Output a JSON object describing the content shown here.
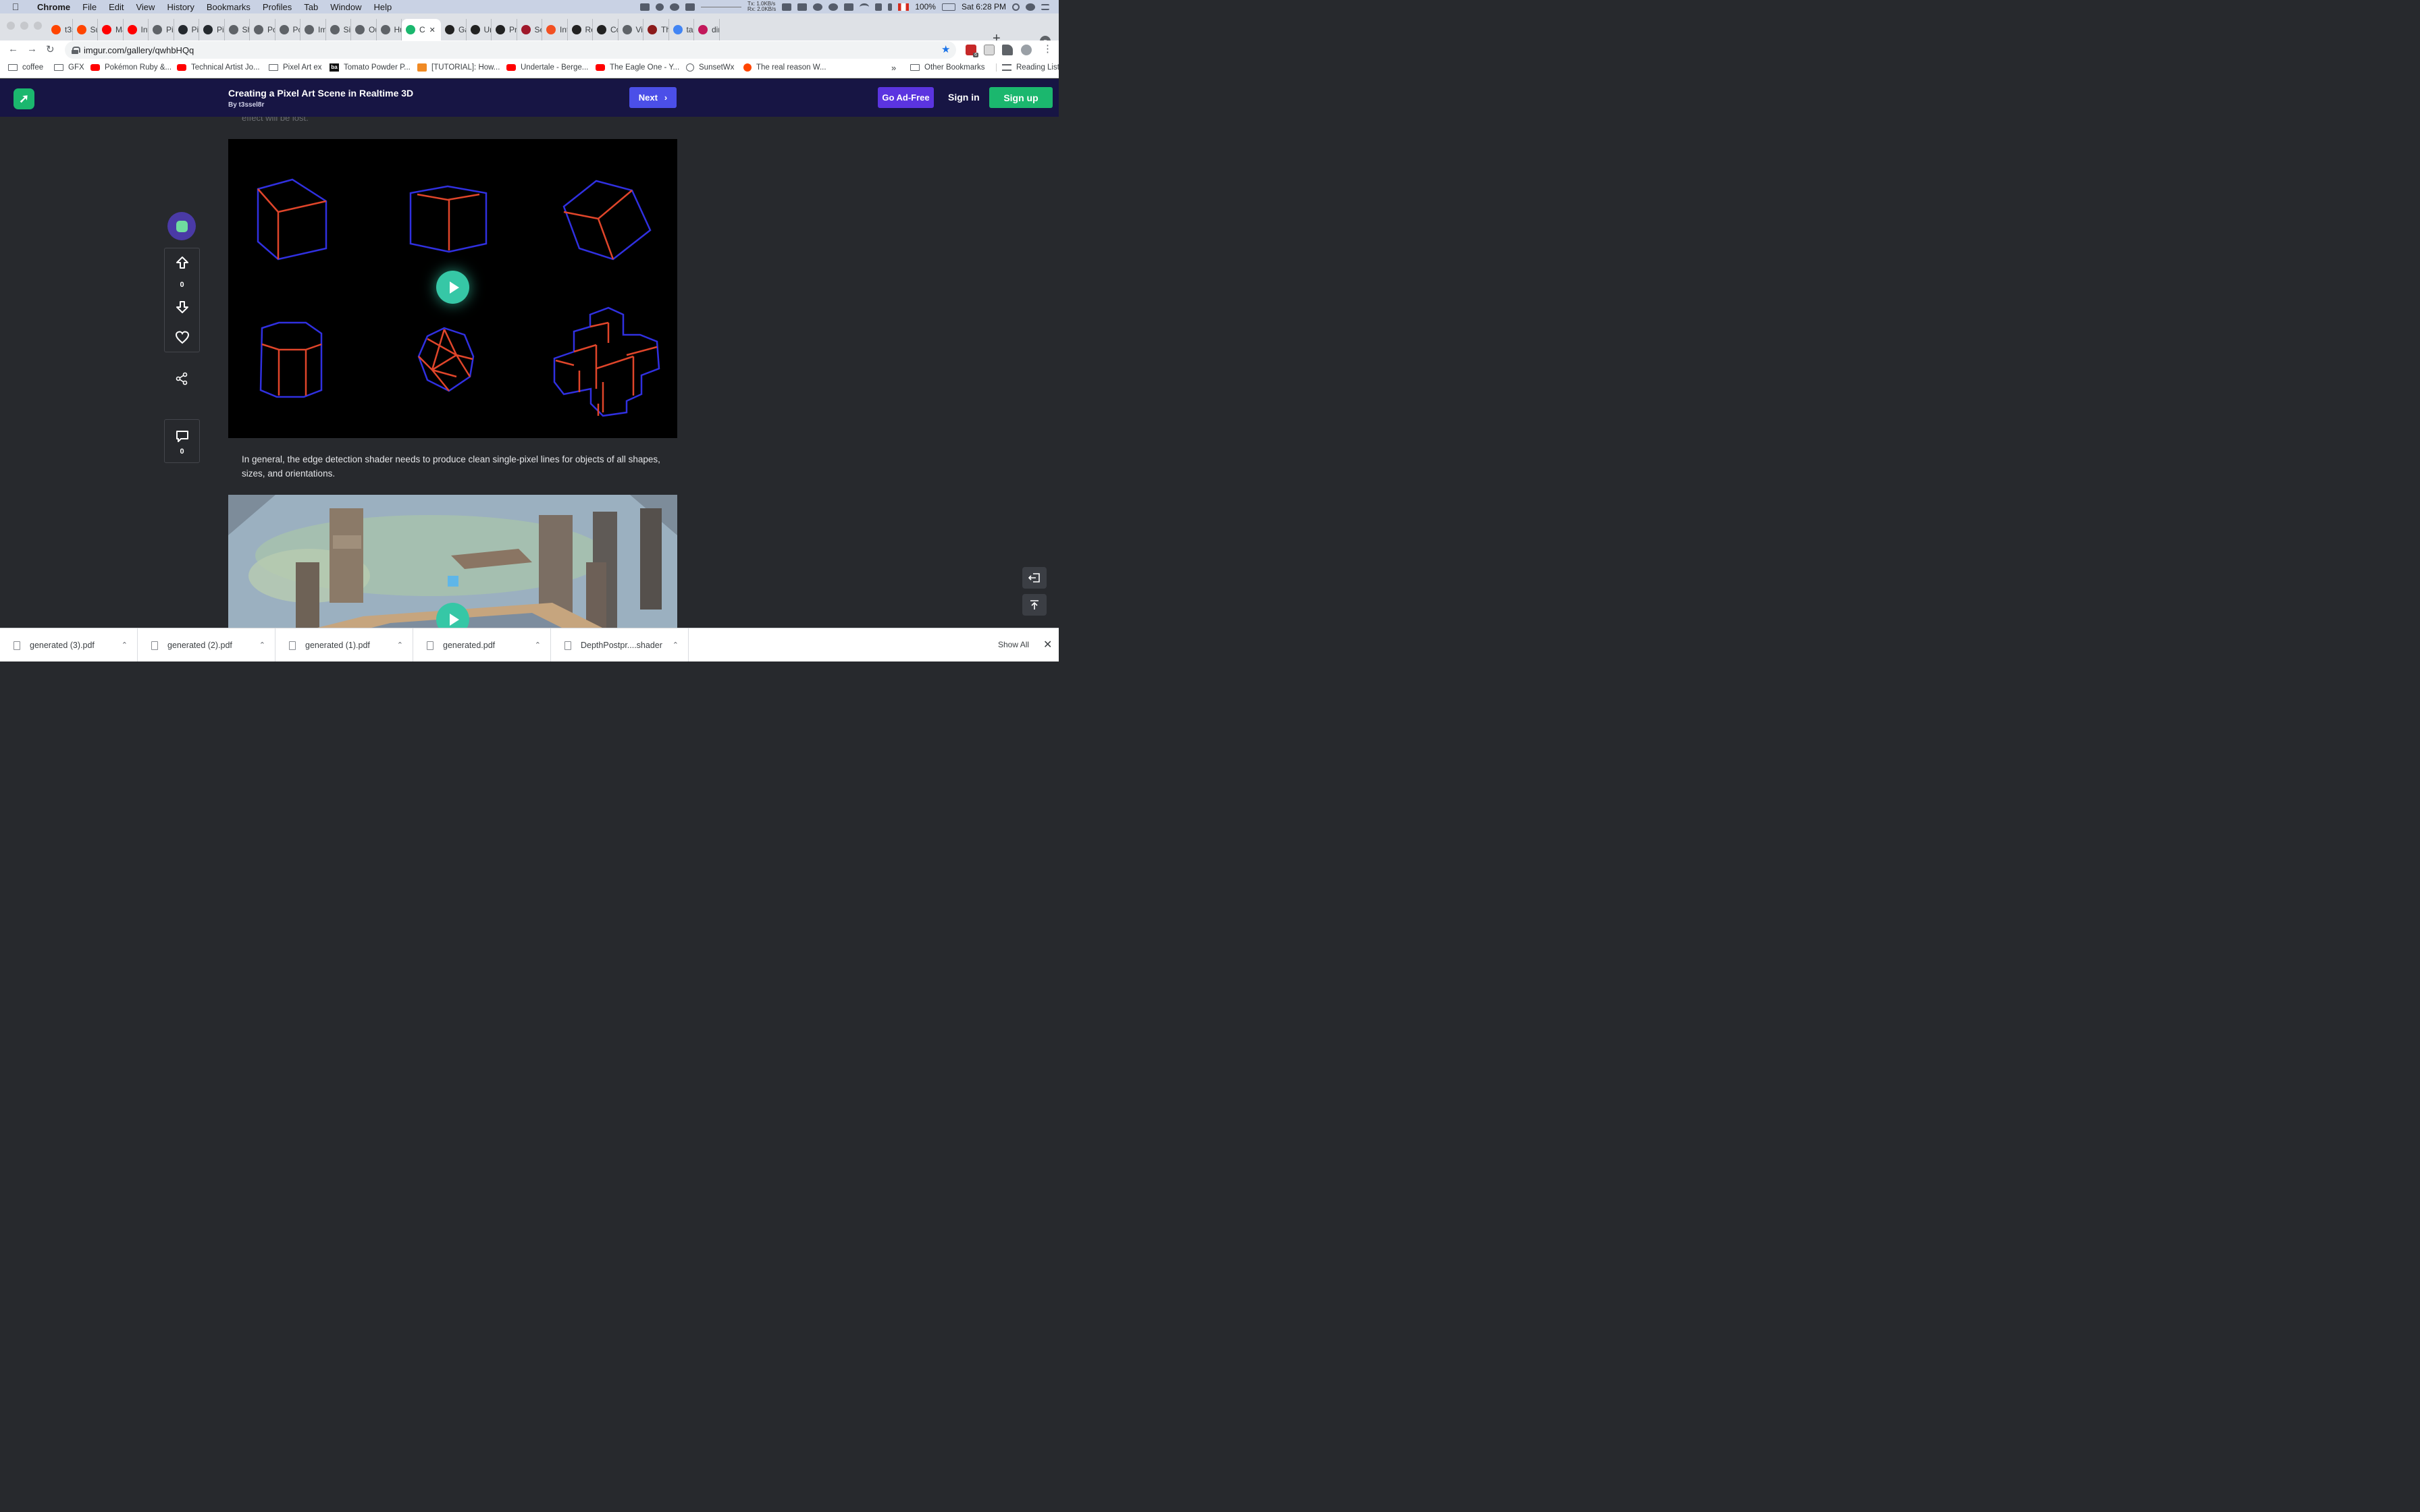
{
  "menubar": {
    "app": "Chrome",
    "items": [
      "File",
      "Edit",
      "View",
      "History",
      "Bookmarks",
      "Profiles",
      "Tab",
      "Window",
      "Help"
    ],
    "net_tx": "Tx: 1.0KB/s",
    "net_rx": "Rx: 2.0KB/s",
    "battery": "100%",
    "clock": "Sat 6:28 PM"
  },
  "tabs": [
    {
      "label": "t3s",
      "icon": "reddit-icon",
      "color": "#ff4500"
    },
    {
      "label": "Sun",
      "icon": "reddit-icon",
      "color": "#ff4500"
    },
    {
      "label": "Mak",
      "icon": "youtube-icon",
      "color": "#ff0000"
    },
    {
      "label": "Intr",
      "icon": "youtube-icon",
      "color": "#ff0000"
    },
    {
      "label": "Pixe",
      "icon": "globe-icon",
      "color": "#5f6368"
    },
    {
      "label": "Pixe",
      "icon": "github-icon",
      "color": "#24292e"
    },
    {
      "label": "Pixe",
      "icon": "github-icon",
      "color": "#24292e"
    },
    {
      "label": "Sha",
      "icon": "globe-icon",
      "color": "#5f6368"
    },
    {
      "label": "Pos",
      "icon": "globe-icon",
      "color": "#5f6368"
    },
    {
      "label": "Pos",
      "icon": "globe-icon",
      "color": "#5f6368"
    },
    {
      "label": "Imp",
      "icon": "globe-icon",
      "color": "#5f6368"
    },
    {
      "label": "Sin",
      "icon": "globe-icon",
      "color": "#5f6368"
    },
    {
      "label": "Out",
      "icon": "globe-icon",
      "color": "#5f6368"
    },
    {
      "label": "Hul",
      "icon": "globe-icon",
      "color": "#5f6368"
    },
    {
      "label": "C",
      "icon": "imgur-icon",
      "color": "#1bb76e",
      "active": true
    },
    {
      "label": "Gan",
      "icon": "paw-icon",
      "color": "#222222"
    },
    {
      "label": "Unit",
      "icon": "paw-icon",
      "color": "#222222"
    },
    {
      "label": "Pro",
      "icon": "paw-icon",
      "color": "#222222"
    },
    {
      "label": "Sec",
      "icon": "star-icon",
      "color": "#a0182b"
    },
    {
      "label": "Intr",
      "icon": "microsoft-icon",
      "color": "#f25022"
    },
    {
      "label": "Ren",
      "icon": "paw-icon",
      "color": "#222222"
    },
    {
      "label": "Con",
      "icon": "paw-icon",
      "color": "#222222"
    },
    {
      "label": "Visu",
      "icon": "globe-icon",
      "color": "#5f6368"
    },
    {
      "label": "The",
      "icon": "book-icon",
      "color": "#8b1a1a"
    },
    {
      "label": "tan",
      "icon": "google-icon",
      "color": "#4285f4"
    },
    {
      "label": "dire",
      "icon": "dots-icon",
      "color": "#c2185b"
    }
  ],
  "toolbar": {
    "url": "imgur.com/gallery/qwhbHQq",
    "ext_badge": "6"
  },
  "bookmarks": [
    {
      "label": "coffee",
      "icon": "folder"
    },
    {
      "label": "GFX",
      "icon": "folder"
    },
    {
      "label": "Pokémon Ruby &...",
      "icon": "yt"
    },
    {
      "label": "Technical Artist Jo...",
      "icon": "yt"
    },
    {
      "label": "Pixel Art ex",
      "icon": "folder"
    },
    {
      "label": "Tomato Powder P...",
      "icon": "ba"
    },
    {
      "label": "[TUTORIAL]: How...",
      "icon": "orange"
    },
    {
      "label": "Undertale - Berge...",
      "icon": "yt"
    },
    {
      "label": "The Eagle One - Y...",
      "icon": "yt"
    },
    {
      "label": "SunsetWx",
      "icon": "globe"
    },
    {
      "label": "The real reason W...",
      "icon": "reddit"
    }
  ],
  "bookmarks_overflow": "»",
  "other_bookmarks": "Other Bookmarks",
  "reading_list": "Reading List",
  "imgur": {
    "title": "Creating a Pixel Art Scene in Realtime 3D",
    "author": "By t3ssel8r",
    "next": "Next",
    "ad_free": "Go Ad-Free",
    "sign_in": "Sign in",
    "sign_up": "Sign up"
  },
  "post": {
    "faded_text": "effect will be lost.",
    "paragraph": "In general, the edge detection shader needs to produce clean single-pixel lines for objects of all shapes, sizes, and orientations.",
    "upvotes": "0",
    "comments": "0"
  },
  "downloads": [
    {
      "name": "generated (3).pdf"
    },
    {
      "name": "generated (2).pdf"
    },
    {
      "name": "generated (1).pdf"
    },
    {
      "name": "generated.pdf"
    },
    {
      "name": "DepthPostpr....shader"
    }
  ],
  "show_all": "Show All",
  "colors": {
    "accent_green": "#1bb76e",
    "header_bg": "#171544",
    "next_blue": "#4b4fe8",
    "adfree_purple": "#5b34e0",
    "edge_blue": "#3030e0",
    "edge_red": "#e0452a"
  }
}
